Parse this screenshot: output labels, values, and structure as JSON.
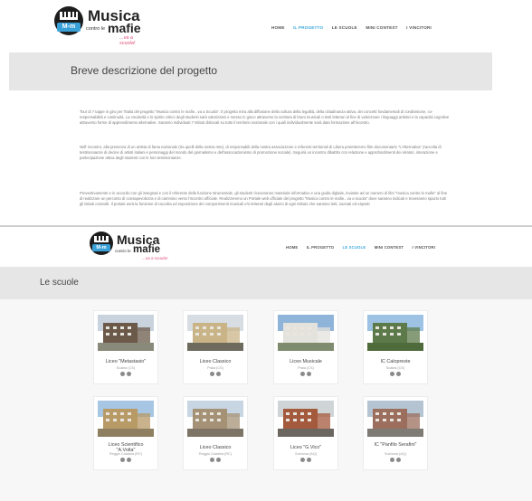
{
  "top": {
    "logo": {
      "icon_text": "M-m",
      "title": "Musica",
      "subtitle_prefix": "contro le",
      "subtitle": "mafie",
      "tagline": "...va a scuola!"
    },
    "nav": [
      {
        "label": "HOME",
        "active": false
      },
      {
        "label": "IL PROGETTO",
        "active": true
      },
      {
        "label": "LE SCUOLE",
        "active": false
      },
      {
        "label": "MINI CONTEST",
        "active": false
      },
      {
        "label": "I VINCITORI",
        "active": false
      }
    ],
    "heading": "Breve descrizione del progetto",
    "paragraphs": [
      "Tour di 7 tappe in giro per l'Italia del progetto \"Musica contro le mafie...va a Scuola\". Il progetto mira alla diffusione della cultura della legalità, della cittadinanza attiva, dei concetti fondamentali di condivisione, co-responsabilità e continuità. La creatività e lo spirito critico degli studenti sarà valorizzato e messo in gioco attraverso la scrittura di brani musicali o testi letterari al fine di valorizzare i linguaggi artistici e la capacità cognitive attraverso forme di apprendimento alternative. Saranno individuati 7 Istituti dislocati su tutto il territorio nazionale con i quali individualmente sarà data formazione all'incontro.",
      "Nell' incontro, alla presenza di un artista di fama nazionale (tra quelli della nostra rete), di responsabili della nostra associazione e referenti territoriali di Libera proietteremo film documentario \"L'Alternativa\" (raccolta di testimonianze di decine di artisti italiani e personaggi del mondo del giornalismo e dell'associazionismo di promozione sociale). Seguirà un incontro dibattito con relazione e approfondimenti dei relatori, interazione e partecipazione attiva degli studenti con le loro testimonianze.",
      "Preventivamente e in accordo con gli insegnati e con il referente della funzione strumentale, gli studenti riceveranno materiale informativo e una guida digitale, inviante ad un numero di libri \"musica contro le mafie\" al fine di realizzare un percorso di consapevolezza e di cammino verso l'incontro ufficiale. Realizzeremo un Portale web ufficiale del progetto \"Musica contro le mafie...va a scuola\" dove saranno indicati e troveranno spazio tutti gli istituti coinvolti. Il portale avrà la funzione di raccolta ed esposizione dei componimenti musicali e/o letterari degli alunni di ogni Istituto che saranno letti, suonati ed esposti"
    ]
  },
  "bottom": {
    "logo": {
      "icon_text": "M-m",
      "title": "Musica",
      "subtitle_prefix": "contro le",
      "subtitle": "mafie",
      "tagline": "...va a scuola!"
    },
    "nav": [
      {
        "label": "HOME",
        "active": false
      },
      {
        "label": "IL PROGETTO",
        "active": false
      },
      {
        "label": "LE SCUOLE",
        "active": true
      },
      {
        "label": "MINI CONTEST",
        "active": false
      },
      {
        "label": "I VINCITORI",
        "active": false
      }
    ],
    "heading": "Le scuole",
    "schools": [
      {
        "name": "Liceo \"Metastasio\"",
        "city": "Scalea (CS)",
        "sky": "#c9d3de",
        "bldg": "#6b5a4a",
        "ground": "#8a8a7a"
      },
      {
        "name": "Liceo Classico",
        "city": "Praia (CS)",
        "sky": "#d7dde3",
        "bldg": "#c9b487",
        "ground": "#6e6a5e"
      },
      {
        "name": "Liceo Musicale",
        "city": "Praia (CS)",
        "sky": "#8fb4d9",
        "bldg": "#e4e2dc",
        "ground": "#7f8b6e"
      },
      {
        "name": "IC Calopreste",
        "city": "Scalea (CS)",
        "sky": "#9ec2e3",
        "bldg": "#5d7a4a",
        "ground": "#4f6b3b"
      },
      {
        "name": "Liceo Scientifico \"A.Volta\"",
        "city": "Reggio Calabria (RC)",
        "sky": "#a7c6e3",
        "bldg": "#b89a66",
        "ground": "#8e7f61"
      },
      {
        "name": "Liceo Classico",
        "city": "Reggio Calabria (RC)",
        "sky": "#c8d6e3",
        "bldg": "#a59276",
        "ground": "#7d7467"
      },
      {
        "name": "Liceo \"G.Vico\"",
        "city": "Sulmona (AQ)",
        "sky": "#cfd5d6",
        "bldg": "#a45a3c",
        "ground": "#6c6660"
      },
      {
        "name": "IC \"Panfilo Serafini\"",
        "city": "Sulmona (AQ)",
        "sky": "#b4c4d2",
        "bldg": "#9b6e5e",
        "ground": "#7e7a74"
      }
    ]
  }
}
